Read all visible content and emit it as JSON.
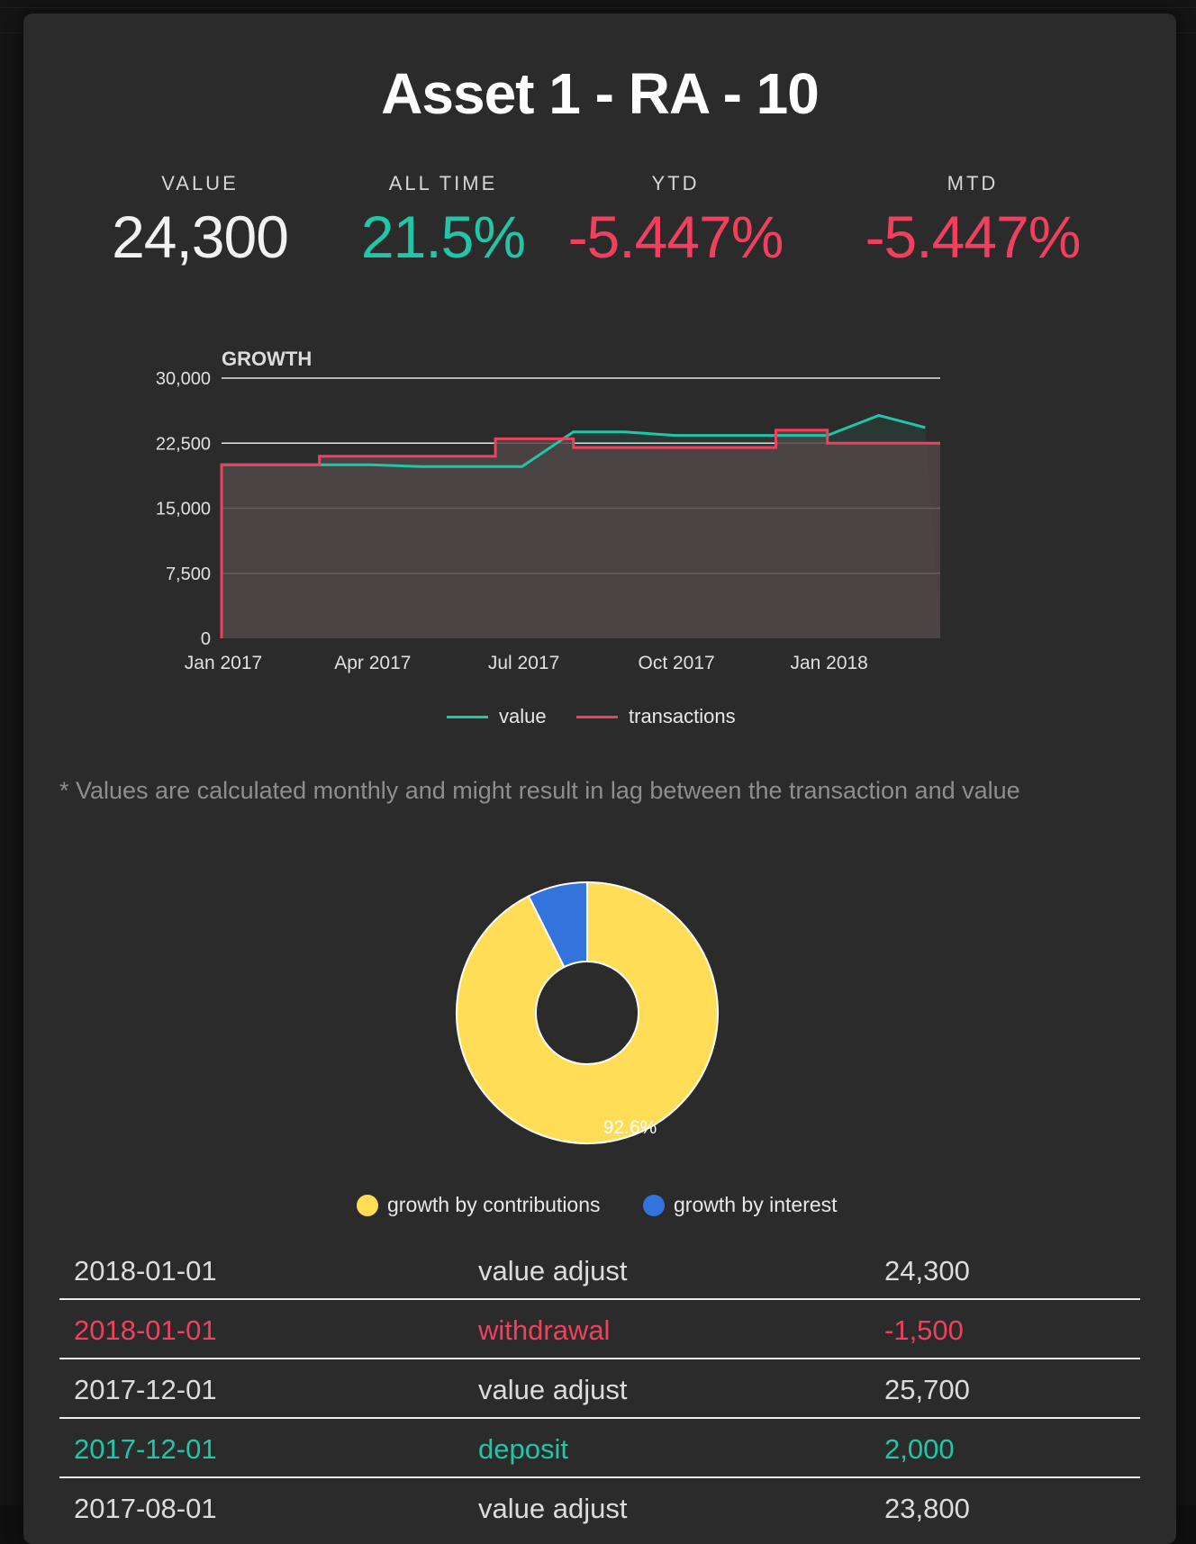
{
  "modal": {
    "title": "Asset 1 - RA - 10"
  },
  "stats": [
    {
      "label": "VALUE",
      "value": "24,300",
      "tone": "neutral"
    },
    {
      "label": "ALL TIME",
      "value": "21.5%",
      "tone": "pos"
    },
    {
      "label": "YTD",
      "value": "-5.447%",
      "tone": "neg"
    },
    {
      "label": "MTD",
      "value": "-5.447%",
      "tone": "neg"
    }
  ],
  "colors": {
    "value": "#1fc6a7",
    "transactions": "#f0405e",
    "contributions": "#ffdd57",
    "interest": "#3273dc"
  },
  "chart_data": [
    {
      "type": "line",
      "title": "GROWTH",
      "ylim": [
        0,
        30000
      ],
      "yticks": [
        "30,000",
        "22,500",
        "15,000",
        "7,500",
        "0"
      ],
      "xticks": [
        "Jan 2017",
        "Apr 2017",
        "Jul 2017",
        "Oct 2017",
        "Jan 2018"
      ],
      "grid": true,
      "legend_position": "bottom",
      "series": [
        {
          "name": "value",
          "color": "#1fc6a7",
          "points": [
            [
              "2017-01-01",
              20000
            ],
            [
              "2017-02-01",
              20000
            ],
            [
              "2017-03-01",
              20000
            ],
            [
              "2017-04-01",
              20000
            ],
            [
              "2017-05-01",
              19800
            ],
            [
              "2017-06-01",
              19800
            ],
            [
              "2017-07-01",
              19800
            ],
            [
              "2017-08-01",
              23800
            ],
            [
              "2017-09-01",
              23800
            ],
            [
              "2017-10-01",
              23400
            ],
            [
              "2017-11-01",
              23400
            ],
            [
              "2017-12-01",
              23400
            ],
            [
              "2018-01-01",
              23400
            ],
            [
              "2018-02-01",
              25700
            ],
            [
              "2018-03-01",
              24300
            ]
          ]
        },
        {
          "name": "transactions",
          "color": "#f0405e",
          "step": true,
          "points": [
            [
              "2017-01-01",
              20000
            ],
            [
              "2017-03-01",
              21000
            ],
            [
              "2017-06-15",
              23000
            ],
            [
              "2017-08-01",
              22000
            ],
            [
              "2017-12-01",
              24000
            ],
            [
              "2018-01-01",
              22500
            ],
            [
              "2018-03-01",
              22500
            ]
          ]
        }
      ]
    },
    {
      "type": "pie",
      "donut": true,
      "legend_position": "bottom",
      "slices": [
        {
          "name": "growth by contributions",
          "value": 92.6,
          "color": "#ffdd57",
          "label": "92.6%"
        },
        {
          "name": "growth by interest",
          "value": 7.4,
          "color": "#3273dc"
        }
      ]
    }
  ],
  "note": "* Values are calculated monthly and might result in lag between the transaction and value",
  "transactions": [
    {
      "date": "2018-01-01",
      "type": "value adjust",
      "amount": "24,300",
      "tone": "neutral"
    },
    {
      "date": "2018-01-01",
      "type": "withdrawal",
      "amount": "-1,500",
      "tone": "neg"
    },
    {
      "date": "2017-12-01",
      "type": "value adjust",
      "amount": "25,700",
      "tone": "neutral"
    },
    {
      "date": "2017-12-01",
      "type": "deposit",
      "amount": "2,000",
      "tone": "pos"
    },
    {
      "date": "2017-08-01",
      "type": "value adjust",
      "amount": "23,800",
      "tone": "neutral"
    }
  ]
}
